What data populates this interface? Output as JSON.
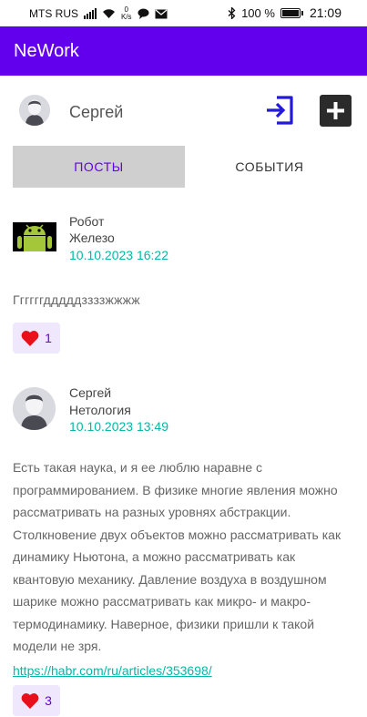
{
  "status_bar": {
    "carrier": "MTS RUS",
    "speed_value": "0",
    "speed_unit": "K/s",
    "battery_text": "100 %",
    "time": "21:09"
  },
  "app_bar": {
    "title": "NeWork"
  },
  "profile": {
    "name": "Сергей"
  },
  "tabs": {
    "posts": "ПОСТЫ",
    "events": "СОБЫТИЯ",
    "active": "posts"
  },
  "posts": [
    {
      "author": "Робот",
      "job": "Железо",
      "date": "10.10.2023 16:22",
      "content": "Ггггггдддддззззжжжж",
      "likes": "1"
    },
    {
      "author": "Сергей",
      "job": "Нетология",
      "date": "10.10.2023 13:49",
      "content": "Есть такая наука, и я ее люблю наравне с программированием. В физике многие явления можно рассматривать на разных уровнях абстракции. Столкновение двух объектов можно рассматривать как динамику Ньютона, а можно рассматривать как квантовую механику. Давление воздуха в воздушном шарике можно рассматривать как микро- и макро-термодинамику. Наверное, физики пришли к такой модели не зря.",
      "link": "https://habr.com/ru/articles/353698/",
      "likes": "3"
    }
  ],
  "colors": {
    "primary": "#6200EE",
    "accent": "#00B9A6",
    "like_heart": "#E8101A",
    "tab_active_bg": "#CFCFCF"
  }
}
